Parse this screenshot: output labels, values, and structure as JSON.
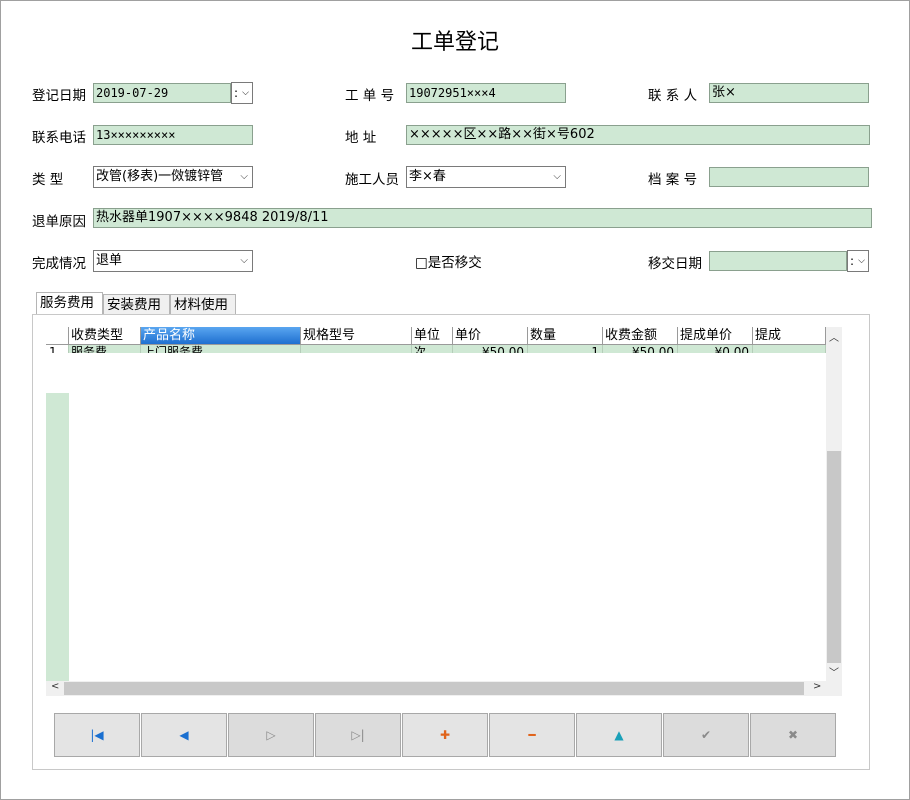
{
  "title": "工单登记",
  "form": {
    "reg_date_label": "登记日期",
    "reg_date_value": "2019-07-29",
    "order_no_label": "工 单 号",
    "order_no_value": "19072951×××4",
    "contact_label": "联 系 人",
    "contact_value": "张×",
    "phone_label": "联系电话",
    "phone_value": "13×××××××××",
    "address_label": "地    址",
    "address_value": "×××××区××路××街×号602",
    "type_label": "类    型",
    "type_value": "改管(移表)一傚镀锌管",
    "worker_label": "施工人员",
    "worker_value": "李×春",
    "archive_label": "档 案 号",
    "archive_value": "",
    "refund_label": "退单原因",
    "refund_value": "热水器单1907××××9848  2019/8/11",
    "status_label": "完成情况",
    "status_value": "退单",
    "transfer_check_label": "□是否移交",
    "transfer_date_label": "移交日期",
    "transfer_date_value": ""
  },
  "tabs": [
    "服务费用",
    "安装费用",
    "材料使用"
  ],
  "grid": {
    "headers": [
      "收费类型",
      "产品名称",
      "规格型号",
      "单位",
      "单价",
      "数量",
      "收费金额",
      "提成单价",
      "提成"
    ],
    "rows": [
      {
        "no": "1",
        "cells": [
          "服务费",
          "上门服务费",
          "",
          "次",
          "¥50.00",
          "1",
          "¥50.00",
          "¥0.00",
          ""
        ]
      }
    ]
  },
  "icons": {
    "spin": ":",
    "dropdown": "⌵",
    "scroll_up": "︿",
    "scroll_down": "﹀",
    "scroll_left": "<",
    "scroll_right": ">"
  },
  "nav": [
    {
      "name": "first-record-button",
      "glyph": "|◀",
      "color": "#1a6fd0",
      "enabled": true
    },
    {
      "name": "prev-record-button",
      "glyph": "◀",
      "color": "#1a6fd0",
      "enabled": true
    },
    {
      "name": "next-record-button",
      "glyph": "▷",
      "color": "#8a8a8a",
      "enabled": false
    },
    {
      "name": "last-record-button",
      "glyph": "▷|",
      "color": "#8a8a8a",
      "enabled": false
    },
    {
      "name": "add-record-button",
      "glyph": "✚",
      "color": "#e0631a",
      "enabled": true
    },
    {
      "name": "delete-record-button",
      "glyph": "━",
      "color": "#e0631a",
      "enabled": true
    },
    {
      "name": "edit-record-button",
      "glyph": "▲",
      "color": "#1aa0b8",
      "enabled": true
    },
    {
      "name": "post-record-button",
      "glyph": "✔",
      "color": "#8a8a8a",
      "enabled": false
    },
    {
      "name": "cancel-record-button",
      "glyph": "✖",
      "color": "#8a8a8a",
      "enabled": false
    }
  ]
}
